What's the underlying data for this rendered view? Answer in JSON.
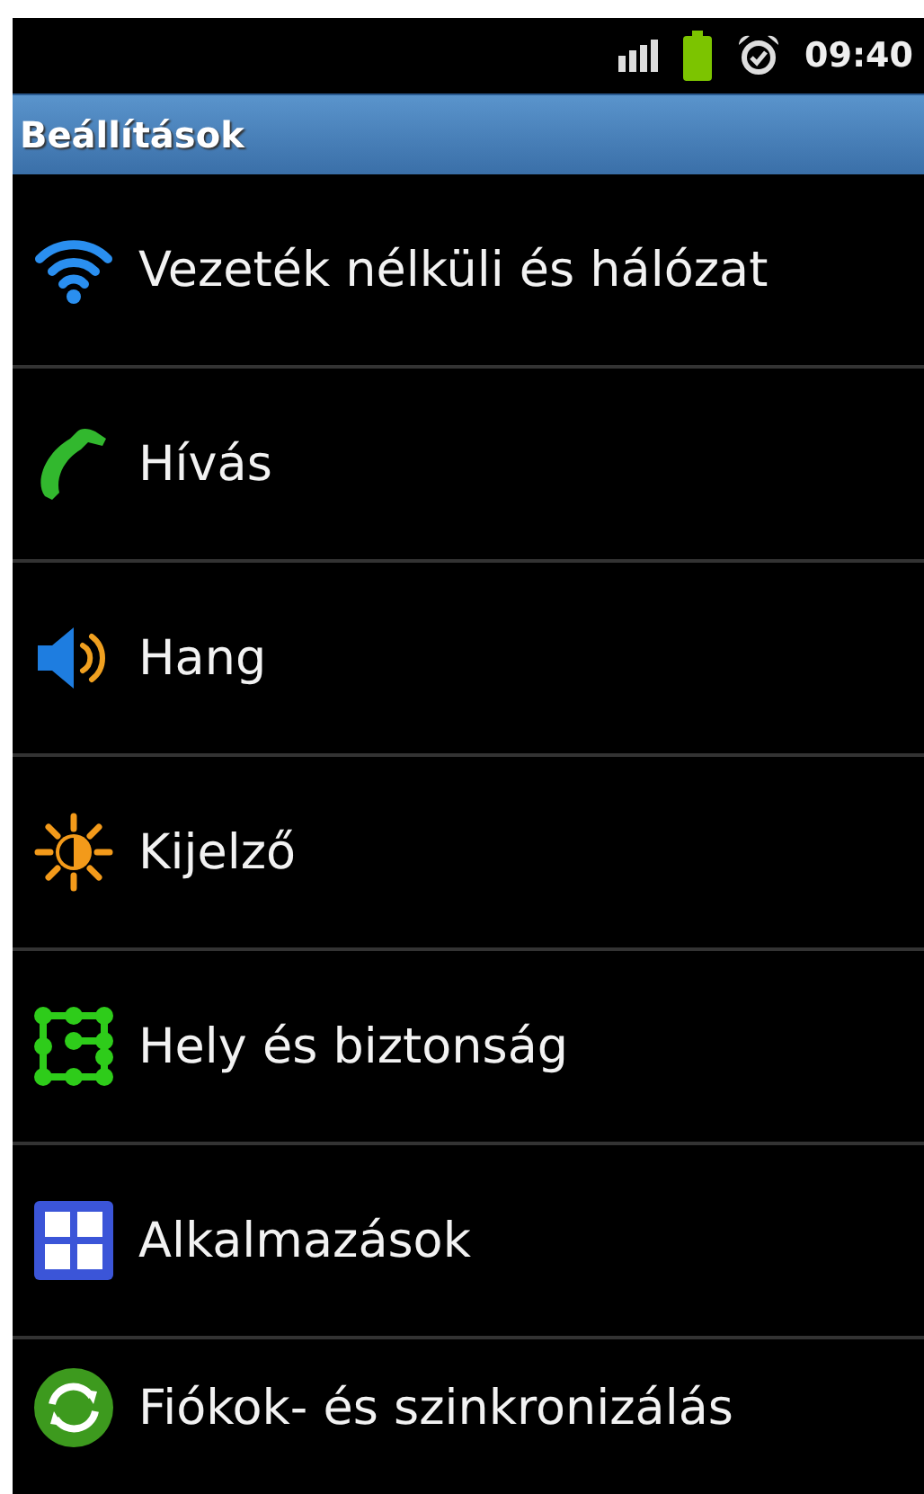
{
  "status_bar": {
    "time": "09:40"
  },
  "title_bar": {
    "title": "Beállítások"
  },
  "settings": [
    {
      "kind": "wifi",
      "label": "Vezeték nélküli és hálózat"
    },
    {
      "kind": "phone",
      "label": "Hívás"
    },
    {
      "kind": "sound",
      "label": "Hang"
    },
    {
      "kind": "display",
      "label": "Kijelző"
    },
    {
      "kind": "security",
      "label": "Hely és biztonság"
    },
    {
      "kind": "apps",
      "label": "Alkalmazások"
    },
    {
      "kind": "sync",
      "label": "Fiókok- és szinkronizálás"
    }
  ]
}
